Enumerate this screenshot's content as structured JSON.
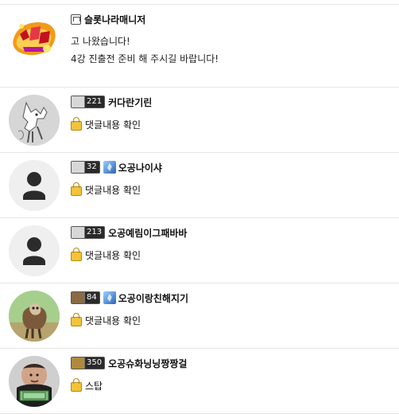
{
  "comments": [
    {
      "avatar_icon": "slot-game-logo-avatar",
      "name": "슬롯나라매니저",
      "is_manager": true,
      "badge": null,
      "crest": false,
      "message_lines": [
        "고 나왔습니다!",
        "4강 진출전 준비 해 주시길 바랍니다!"
      ],
      "locked_text": null
    },
    {
      "avatar_icon": "giraffe-sketch-avatar",
      "name": "커다란기린",
      "is_manager": false,
      "badge": {
        "level": "221"
      },
      "crest": false,
      "message_lines": [],
      "locked_text": "댓글내용 확인"
    },
    {
      "avatar_icon": "default-user-avatar",
      "name": "오공나이샤",
      "is_manager": false,
      "badge": {
        "level": "32"
      },
      "crest": true,
      "message_lines": [],
      "locked_text": "댓글내용 확인"
    },
    {
      "avatar_icon": "default-user-avatar",
      "name": "오공예림이그패바바",
      "is_manager": false,
      "badge": {
        "level": "213"
      },
      "crest": false,
      "message_lines": [],
      "locked_text": "댓글내용 확인"
    },
    {
      "avatar_icon": "dog-photo-avatar",
      "name": "오공이랑친해지기",
      "is_manager": false,
      "badge": {
        "level": "84"
      },
      "crest": true,
      "message_lines": [],
      "locked_text": "댓글내용 확인"
    },
    {
      "avatar_icon": "man-with-cash-avatar",
      "name": "오공슈화닝닝짱짱걸",
      "is_manager": false,
      "badge": {
        "level": "350"
      },
      "crest": false,
      "message_lines": [],
      "locked_text": "스탑"
    }
  ]
}
